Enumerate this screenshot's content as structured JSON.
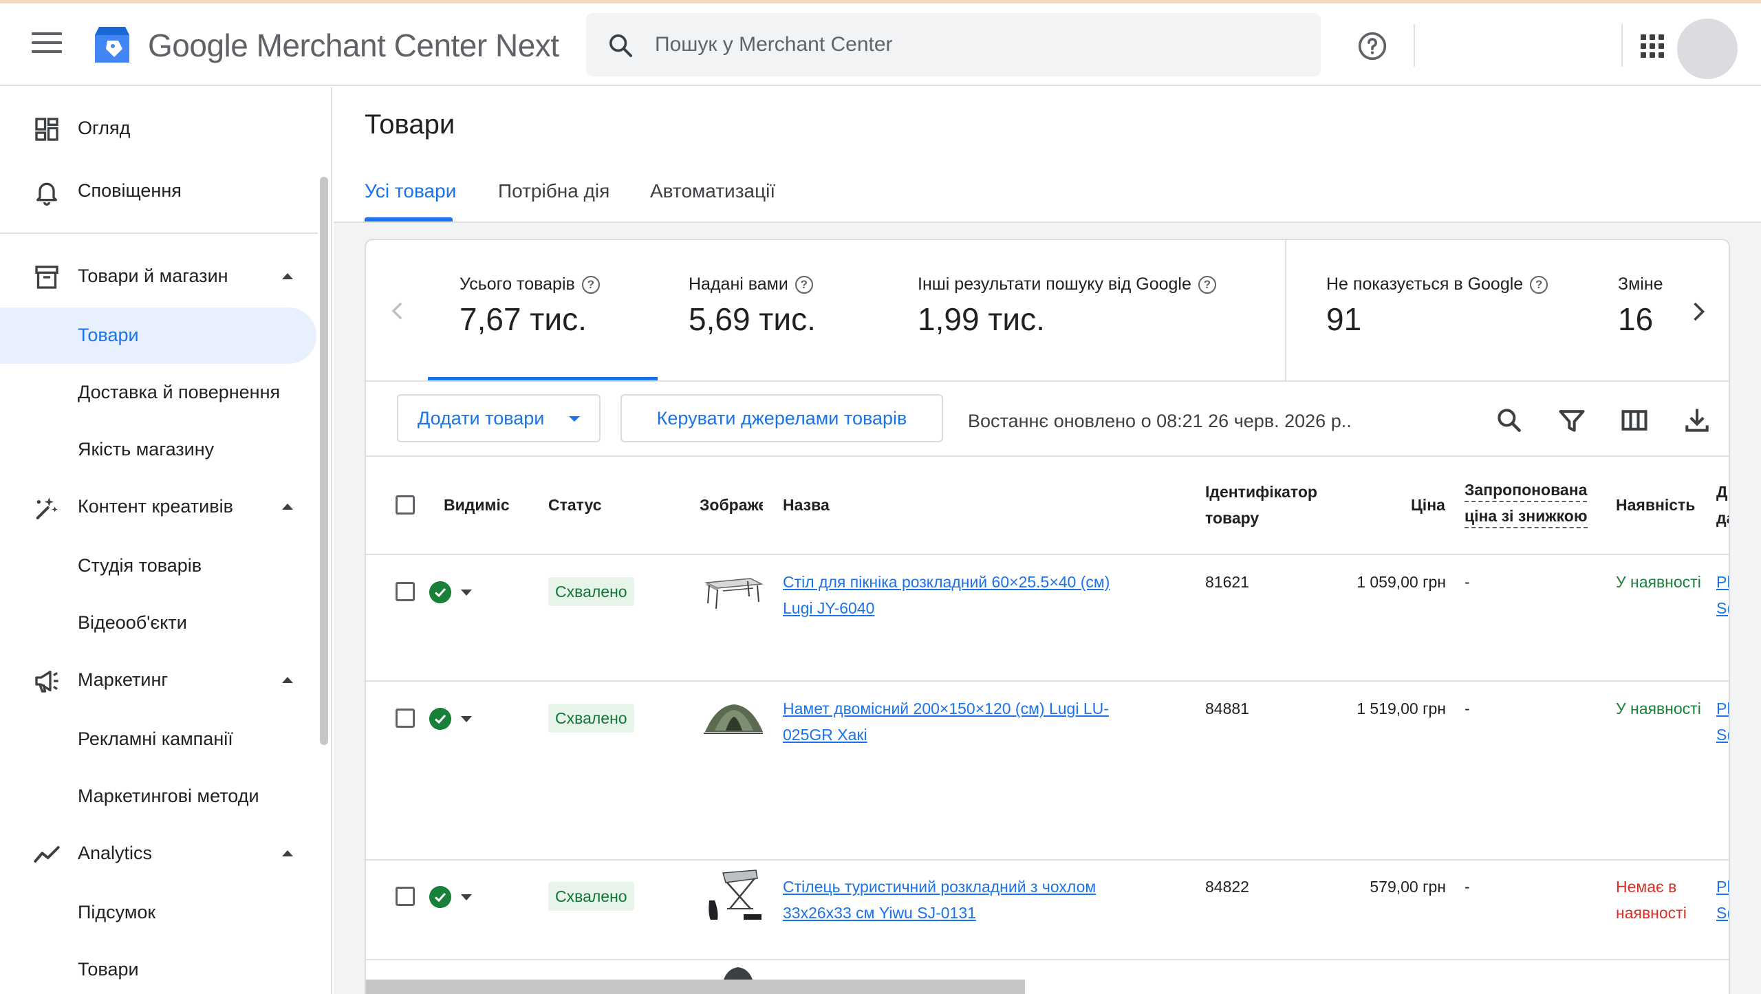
{
  "header": {
    "app_title": "Google Merchant Center Next",
    "search_placeholder": "Пошук у Merchant Center"
  },
  "sidebar": {
    "items": [
      {
        "label": "Огляд"
      },
      {
        "label": "Сповіщення"
      },
      {
        "label": "Товари й магазин"
      },
      {
        "label": "Товари"
      },
      {
        "label": "Доставка й повернення"
      },
      {
        "label": "Якість магазину"
      },
      {
        "label": "Контент креативів"
      },
      {
        "label": "Студія товарів"
      },
      {
        "label": "Відеооб'єкти"
      },
      {
        "label": "Маркетинг"
      },
      {
        "label": "Рекламні кампанії"
      },
      {
        "label": "Маркетингові методи"
      },
      {
        "label": "Analytics"
      },
      {
        "label": "Підсумок"
      },
      {
        "label": "Товари"
      }
    ]
  },
  "main": {
    "title": "Товари",
    "tabs": [
      {
        "label": "Усі товари"
      },
      {
        "label": "Потрібна дія"
      },
      {
        "label": "Автоматизації"
      }
    ],
    "metrics": [
      {
        "label": "Усього товарів",
        "value": "7,67 тис."
      },
      {
        "label": "Надані вами",
        "value": "5,69 тис."
      },
      {
        "label": "Інші результати пошуку від Google",
        "value": "1,99 тис."
      },
      {
        "label": "Не показується в Google",
        "value": "91"
      },
      {
        "label": "Зміне",
        "value": "16"
      }
    ],
    "toolbar": {
      "add_products": "Додати товари",
      "manage_sources": "Керувати джерелами товарів",
      "last_updated": "Востаннє оновлено о 08:21 26 черв. 2026 р.."
    },
    "table": {
      "headers": {
        "visibility": "Видиміс",
        "status": "Статус",
        "image": "Зображе",
        "name": "Назва",
        "id_line1": "Ідентифікатор",
        "id_line2": "товару",
        "price": "Ціна",
        "sale_line1": "Запропонована",
        "sale_line2": "ціна зі знижкою",
        "availability": "Наявність",
        "extra_line1": "Д",
        "extra_line2": "да"
      },
      "rows": [
        {
          "status": "Схвалено",
          "name": "Стіл для пікніка розкладний 60×25.5×40 (см) Lugi JY-6040",
          "id": "81621",
          "price": "1 059,00 грн",
          "sale_price": "-",
          "availability": "У наявності",
          "extra_1": "Pl",
          "extra_2": "S("
        },
        {
          "status": "Схвалено",
          "name": "Намет двомісний 200×150×120 (см) Lugi LU-025GR Хакі",
          "id": "84881",
          "price": "1 519,00 грн",
          "sale_price": "-",
          "availability": "У наявності",
          "extra_1": "Pl",
          "extra_2": "S("
        },
        {
          "status": "Схвалено",
          "name": "Стілець туристичний розкладний з чохлом 33х26х33 см Yiwu SJ-0131",
          "id": "84822",
          "price": "579,00 грн",
          "sale_price": "-",
          "availability": "Немає в наявності",
          "extra_1": "Pl",
          "extra_2": "S("
        }
      ]
    }
  },
  "colors": {
    "accent": "#1a73e8",
    "approved_bg": "#e6f4ea",
    "approved_text": "#137333",
    "in_stock": "#188038",
    "out_of_stock": "#d93025"
  },
  "icons": [
    "menu-icon",
    "merchant-center-logo-icon",
    "search-icon",
    "help-icon",
    "apps-grid-icon",
    "dashboard-icon",
    "bell-icon",
    "archive-box-icon",
    "sparkle-pen-icon",
    "megaphone-icon",
    "trending-line-icon",
    "chevron-left-icon",
    "chevron-right-icon",
    "dropdown-arrow-icon",
    "filter-icon",
    "columns-icon",
    "download-icon",
    "check-circle-icon"
  ]
}
